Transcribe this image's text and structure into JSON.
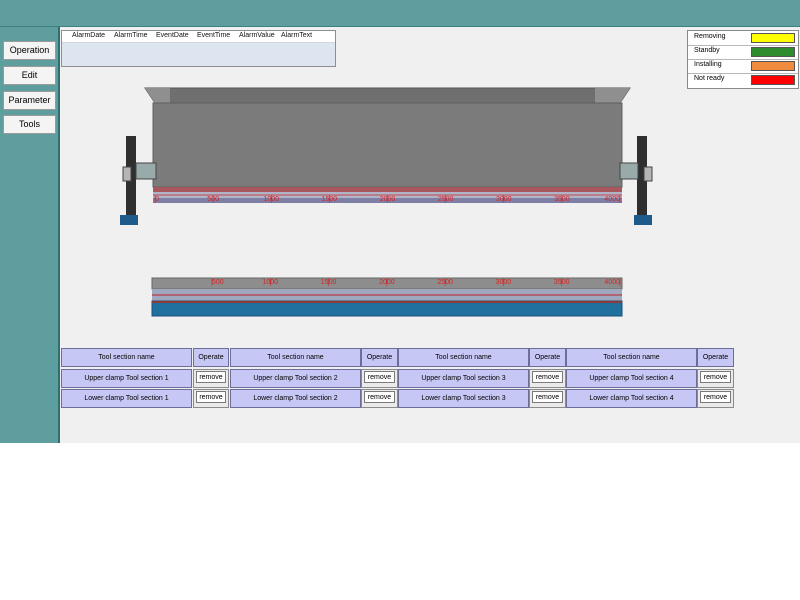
{
  "nav": {
    "operation": "Operation",
    "edit": "Edit",
    "parameter": "Parameter",
    "tools": "Tools"
  },
  "alarm_table": {
    "columns": [
      "AlarmDate",
      "AlarmTime",
      "EventDate",
      "EventTime",
      "AlarmValue",
      "AlarmText"
    ]
  },
  "legend": [
    {
      "label": "Removing",
      "color": "#ffff00"
    },
    {
      "label": "Standby",
      "color": "#2e8b2e"
    },
    {
      "label": "Installing",
      "color": "#f08a3c"
    },
    {
      "label": "Not ready",
      "color": "#ff0000"
    }
  ],
  "ruler": {
    "upper": [
      "0",
      "500",
      "1000",
      "1500",
      "2000",
      "2500",
      "3000",
      "3500",
      "4000"
    ],
    "lower": [
      "500",
      "1000",
      "1500",
      "2000",
      "2500",
      "3000",
      "3500",
      "4000"
    ]
  },
  "tool_table": {
    "header_name": "Tool section name",
    "header_operate": "Operate",
    "remove_label": "remove",
    "upper": [
      "Upper clamp Tool section 1",
      "Upper clamp Tool section 2",
      "Upper clamp Tool section 3",
      "Upper clamp Tool section 4"
    ],
    "lower": [
      "Lower clamp Tool section 1",
      "Lower clamp Tool section 2",
      "Lower clamp Tool section 3",
      "Lower clamp Tool section 4"
    ]
  }
}
